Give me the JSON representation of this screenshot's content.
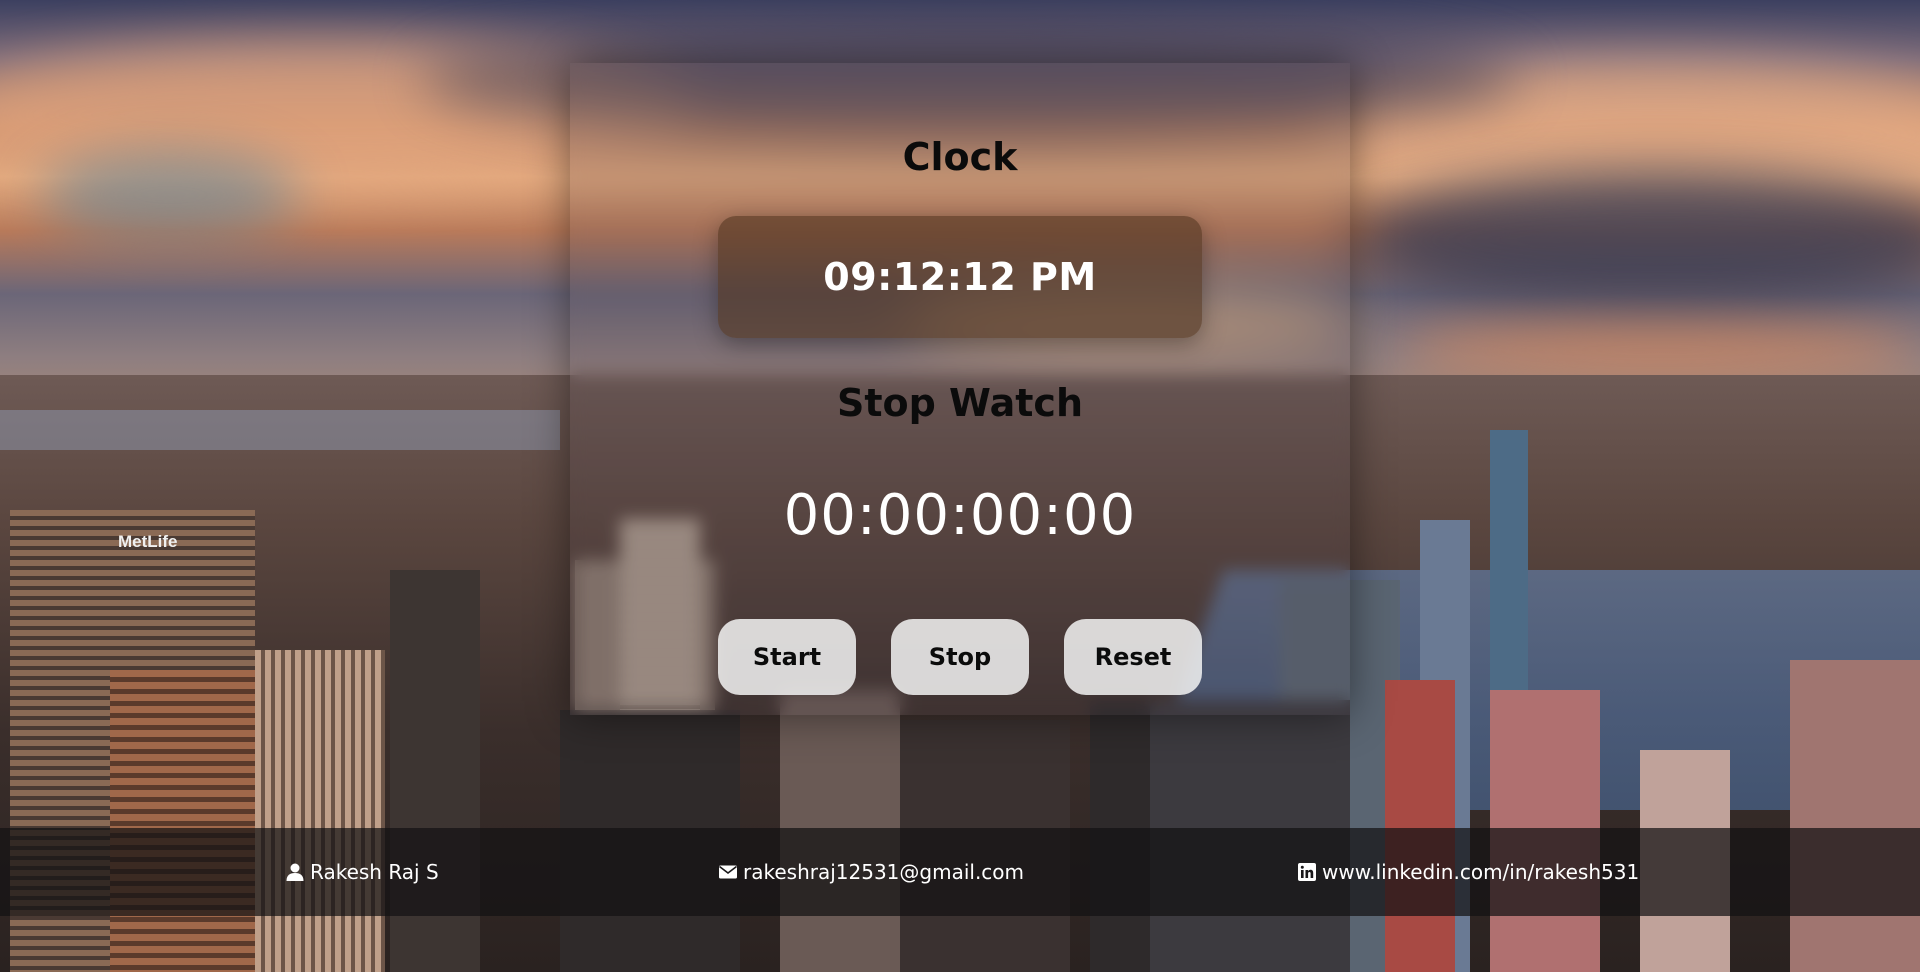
{
  "clock": {
    "title": "Clock",
    "time": "09:12:12 PM"
  },
  "stopwatch": {
    "title": "Stop Watch",
    "time": "00:00:00:00",
    "buttons": {
      "start": "Start",
      "stop": "Stop",
      "reset": "Reset"
    }
  },
  "background": {
    "sign_text": "MetLife"
  },
  "footer": {
    "name": "Rakesh Raj S",
    "email": "rakeshraj12531@gmail.com",
    "linkedin": "www.linkedin.com/in/rakesh531",
    "icons": [
      "user-icon",
      "envelope-icon",
      "linkedin-icon"
    ]
  },
  "colors": {
    "title_text": "#0b0b0b",
    "time_text": "#ffffff",
    "button_bg": "#f5f5f5",
    "footer_bg": "#141214"
  }
}
